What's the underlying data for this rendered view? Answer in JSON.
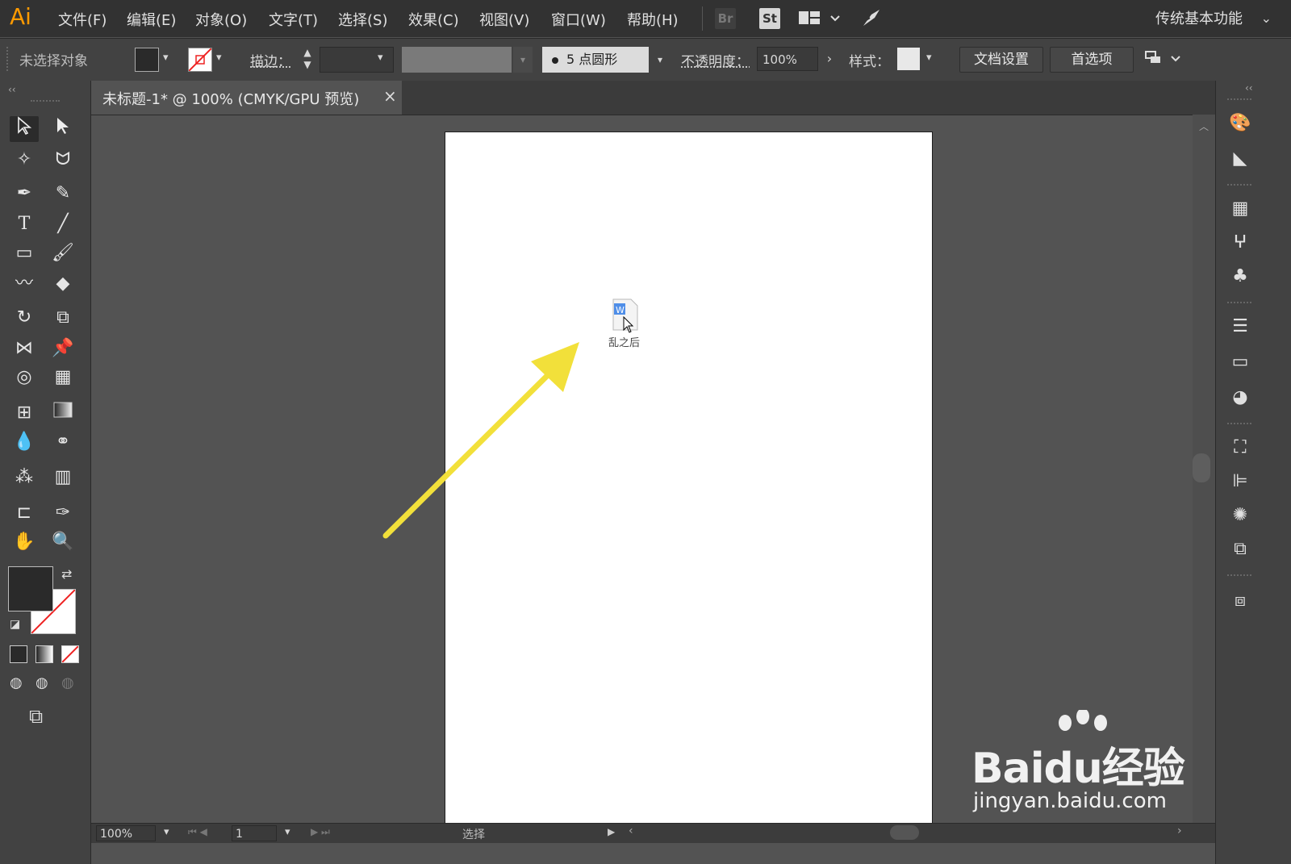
{
  "app": {
    "logo": "Ai"
  },
  "menubar": {
    "items": [
      "文件(F)",
      "编辑(E)",
      "对象(O)",
      "文字(T)",
      "选择(S)",
      "效果(C)",
      "视图(V)",
      "窗口(W)",
      "帮助(H)"
    ],
    "bridge_label": "Br",
    "stock_label": "St",
    "workspace": "传统基本功能"
  },
  "controlbar": {
    "selection_status": "未选择对象",
    "stroke_label": "描边：",
    "brush_label": "5 点圆形",
    "opacity_label": "不透明度：",
    "opacity_value": "100%",
    "style_label": "样式：",
    "doc_setup_button": "文档设置",
    "prefs_button": "首选项"
  },
  "document": {
    "tab_title": "未标题-1* @ 100% (CMYK/GPU 预览)",
    "close_glyph": "×",
    "dragged_file_label": "乱之后"
  },
  "statusbar": {
    "zoom": "100%",
    "artboard_number": "1",
    "status_text": "选择"
  },
  "watermark": {
    "brand": "Baidu经验",
    "url": "jingyan.baidu.com"
  },
  "colors": {
    "menubar_bg": "#323232",
    "panel_bg": "#424242",
    "canvas_bg": "#535353",
    "logo": "#ff9a00",
    "arrow": "#f2e03a"
  }
}
